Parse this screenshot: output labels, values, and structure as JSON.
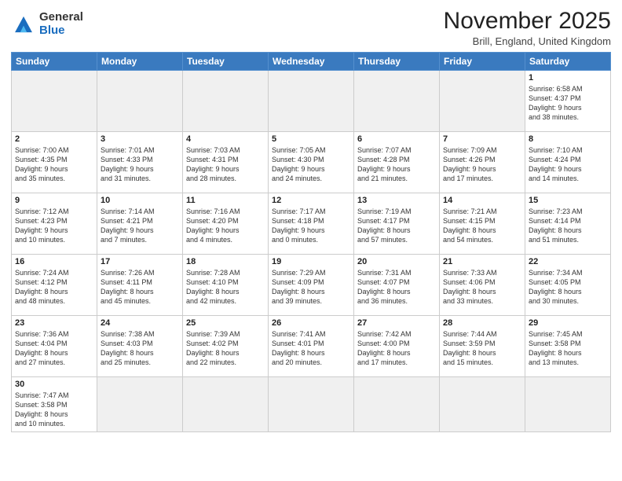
{
  "logo": {
    "line1": "General",
    "line2": "Blue"
  },
  "title": "November 2025",
  "subtitle": "Brill, England, United Kingdom",
  "days_of_week": [
    "Sunday",
    "Monday",
    "Tuesday",
    "Wednesday",
    "Thursday",
    "Friday",
    "Saturday"
  ],
  "weeks": [
    [
      {
        "day": "",
        "empty": true,
        "info": ""
      },
      {
        "day": "",
        "empty": true,
        "info": ""
      },
      {
        "day": "",
        "empty": true,
        "info": ""
      },
      {
        "day": "",
        "empty": true,
        "info": ""
      },
      {
        "day": "",
        "empty": true,
        "info": ""
      },
      {
        "day": "",
        "empty": true,
        "info": ""
      },
      {
        "day": "1",
        "empty": false,
        "info": "Sunrise: 6:58 AM\nSunset: 4:37 PM\nDaylight: 9 hours\nand 38 minutes."
      }
    ],
    [
      {
        "day": "2",
        "empty": false,
        "info": "Sunrise: 7:00 AM\nSunset: 4:35 PM\nDaylight: 9 hours\nand 35 minutes."
      },
      {
        "day": "3",
        "empty": false,
        "info": "Sunrise: 7:01 AM\nSunset: 4:33 PM\nDaylight: 9 hours\nand 31 minutes."
      },
      {
        "day": "4",
        "empty": false,
        "info": "Sunrise: 7:03 AM\nSunset: 4:31 PM\nDaylight: 9 hours\nand 28 minutes."
      },
      {
        "day": "5",
        "empty": false,
        "info": "Sunrise: 7:05 AM\nSunset: 4:30 PM\nDaylight: 9 hours\nand 24 minutes."
      },
      {
        "day": "6",
        "empty": false,
        "info": "Sunrise: 7:07 AM\nSunset: 4:28 PM\nDaylight: 9 hours\nand 21 minutes."
      },
      {
        "day": "7",
        "empty": false,
        "info": "Sunrise: 7:09 AM\nSunset: 4:26 PM\nDaylight: 9 hours\nand 17 minutes."
      },
      {
        "day": "8",
        "empty": false,
        "info": "Sunrise: 7:10 AM\nSunset: 4:24 PM\nDaylight: 9 hours\nand 14 minutes."
      }
    ],
    [
      {
        "day": "9",
        "empty": false,
        "info": "Sunrise: 7:12 AM\nSunset: 4:23 PM\nDaylight: 9 hours\nand 10 minutes."
      },
      {
        "day": "10",
        "empty": false,
        "info": "Sunrise: 7:14 AM\nSunset: 4:21 PM\nDaylight: 9 hours\nand 7 minutes."
      },
      {
        "day": "11",
        "empty": false,
        "info": "Sunrise: 7:16 AM\nSunset: 4:20 PM\nDaylight: 9 hours\nand 4 minutes."
      },
      {
        "day": "12",
        "empty": false,
        "info": "Sunrise: 7:17 AM\nSunset: 4:18 PM\nDaylight: 9 hours\nand 0 minutes."
      },
      {
        "day": "13",
        "empty": false,
        "info": "Sunrise: 7:19 AM\nSunset: 4:17 PM\nDaylight: 8 hours\nand 57 minutes."
      },
      {
        "day": "14",
        "empty": false,
        "info": "Sunrise: 7:21 AM\nSunset: 4:15 PM\nDaylight: 8 hours\nand 54 minutes."
      },
      {
        "day": "15",
        "empty": false,
        "info": "Sunrise: 7:23 AM\nSunset: 4:14 PM\nDaylight: 8 hours\nand 51 minutes."
      }
    ],
    [
      {
        "day": "16",
        "empty": false,
        "info": "Sunrise: 7:24 AM\nSunset: 4:12 PM\nDaylight: 8 hours\nand 48 minutes."
      },
      {
        "day": "17",
        "empty": false,
        "info": "Sunrise: 7:26 AM\nSunset: 4:11 PM\nDaylight: 8 hours\nand 45 minutes."
      },
      {
        "day": "18",
        "empty": false,
        "info": "Sunrise: 7:28 AM\nSunset: 4:10 PM\nDaylight: 8 hours\nand 42 minutes."
      },
      {
        "day": "19",
        "empty": false,
        "info": "Sunrise: 7:29 AM\nSunset: 4:09 PM\nDaylight: 8 hours\nand 39 minutes."
      },
      {
        "day": "20",
        "empty": false,
        "info": "Sunrise: 7:31 AM\nSunset: 4:07 PM\nDaylight: 8 hours\nand 36 minutes."
      },
      {
        "day": "21",
        "empty": false,
        "info": "Sunrise: 7:33 AM\nSunset: 4:06 PM\nDaylight: 8 hours\nand 33 minutes."
      },
      {
        "day": "22",
        "empty": false,
        "info": "Sunrise: 7:34 AM\nSunset: 4:05 PM\nDaylight: 8 hours\nand 30 minutes."
      }
    ],
    [
      {
        "day": "23",
        "empty": false,
        "info": "Sunrise: 7:36 AM\nSunset: 4:04 PM\nDaylight: 8 hours\nand 27 minutes."
      },
      {
        "day": "24",
        "empty": false,
        "info": "Sunrise: 7:38 AM\nSunset: 4:03 PM\nDaylight: 8 hours\nand 25 minutes."
      },
      {
        "day": "25",
        "empty": false,
        "info": "Sunrise: 7:39 AM\nSunset: 4:02 PM\nDaylight: 8 hours\nand 22 minutes."
      },
      {
        "day": "26",
        "empty": false,
        "info": "Sunrise: 7:41 AM\nSunset: 4:01 PM\nDaylight: 8 hours\nand 20 minutes."
      },
      {
        "day": "27",
        "empty": false,
        "info": "Sunrise: 7:42 AM\nSunset: 4:00 PM\nDaylight: 8 hours\nand 17 minutes."
      },
      {
        "day": "28",
        "empty": false,
        "info": "Sunrise: 7:44 AM\nSunset: 3:59 PM\nDaylight: 8 hours\nand 15 minutes."
      },
      {
        "day": "29",
        "empty": false,
        "info": "Sunrise: 7:45 AM\nSunset: 3:58 PM\nDaylight: 8 hours\nand 13 minutes."
      }
    ],
    [
      {
        "day": "30",
        "empty": false,
        "info": "Sunrise: 7:47 AM\nSunset: 3:58 PM\nDaylight: 8 hours\nand 10 minutes."
      },
      {
        "day": "",
        "empty": true,
        "info": ""
      },
      {
        "day": "",
        "empty": true,
        "info": ""
      },
      {
        "day": "",
        "empty": true,
        "info": ""
      },
      {
        "day": "",
        "empty": true,
        "info": ""
      },
      {
        "day": "",
        "empty": true,
        "info": ""
      },
      {
        "day": "",
        "empty": true,
        "info": ""
      }
    ]
  ]
}
